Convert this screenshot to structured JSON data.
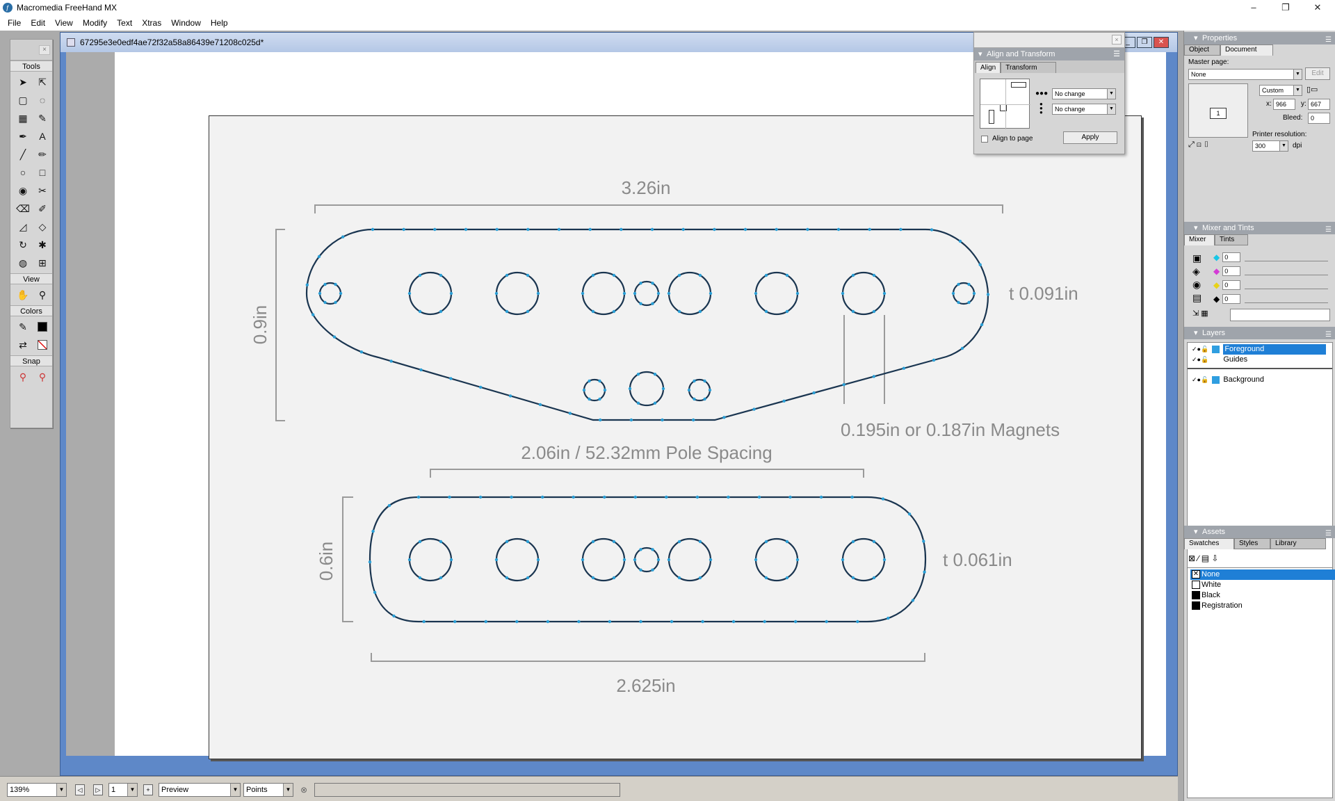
{
  "window": {
    "title": "Macromedia FreeHand MX",
    "controls": [
      "–",
      "❐",
      "✕"
    ]
  },
  "menu": [
    "File",
    "Edit",
    "View",
    "Modify",
    "Text",
    "Xtras",
    "Window",
    "Help"
  ],
  "tools_palette": {
    "title": "Tools",
    "view_title": "View",
    "colors_title": "Colors",
    "snap_title": "Snap"
  },
  "document": {
    "title": "67295e3e0edf4ae72f32a58a86439e71208c025d*"
  },
  "drawing": {
    "dim_top_width": "3.26in",
    "dim_top_height": "0.9in",
    "thickness_top": "t 0.091in",
    "magnets": "0.195in or 0.187in Magnets",
    "pole_spacing": "2.06in / 52.32mm Pole Spacing",
    "dim_bottom_height": "0.6in",
    "thickness_bottom": "t 0.061in",
    "dim_bottom_width": "2.625in"
  },
  "align_panel": {
    "title": "Align and Transform",
    "tabs": [
      "Align",
      "Transform"
    ],
    "horizontal": "No change",
    "vertical": "No change",
    "align_to_page": "Align to page",
    "apply": "Apply"
  },
  "properties": {
    "title": "Properties",
    "tabs": [
      "Object",
      "Document"
    ],
    "master_page_label": "Master page:",
    "master_page_value": "None",
    "edit_label": "Edit",
    "size_value": "Custom",
    "x_label": "x:",
    "x_value": "966",
    "y_label": "y:",
    "y_value": "667",
    "bleed_label": "Bleed:",
    "bleed_value": "0",
    "page_number": "1",
    "printer_res_label": "Printer resolution:",
    "printer_res_value": "300",
    "dpi_label": "dpi"
  },
  "mixer": {
    "title": "Mixer and Tints",
    "tabs": [
      "Mixer",
      "Tints"
    ],
    "values": [
      "0",
      "0",
      "0",
      "0"
    ]
  },
  "layers": {
    "title": "Layers",
    "items": [
      "Foreground",
      "Guides",
      "Background"
    ]
  },
  "assets": {
    "title": "Assets",
    "tabs": [
      "Swatches",
      "Styles",
      "Library"
    ],
    "swatches": [
      "None",
      "White",
      "Black",
      "Registration"
    ]
  },
  "statusbar": {
    "zoom": "139%",
    "page": "1",
    "render_mode": "Preview",
    "units": "Points"
  },
  "colors": {
    "path_stroke": "#1a3550",
    "anchor": "#2a9fd6",
    "dimension": "#9a9a9a",
    "dimension_text": "#8a8a8a",
    "selection": "#1f7fd6",
    "layer_color": "#2f9ee0"
  }
}
